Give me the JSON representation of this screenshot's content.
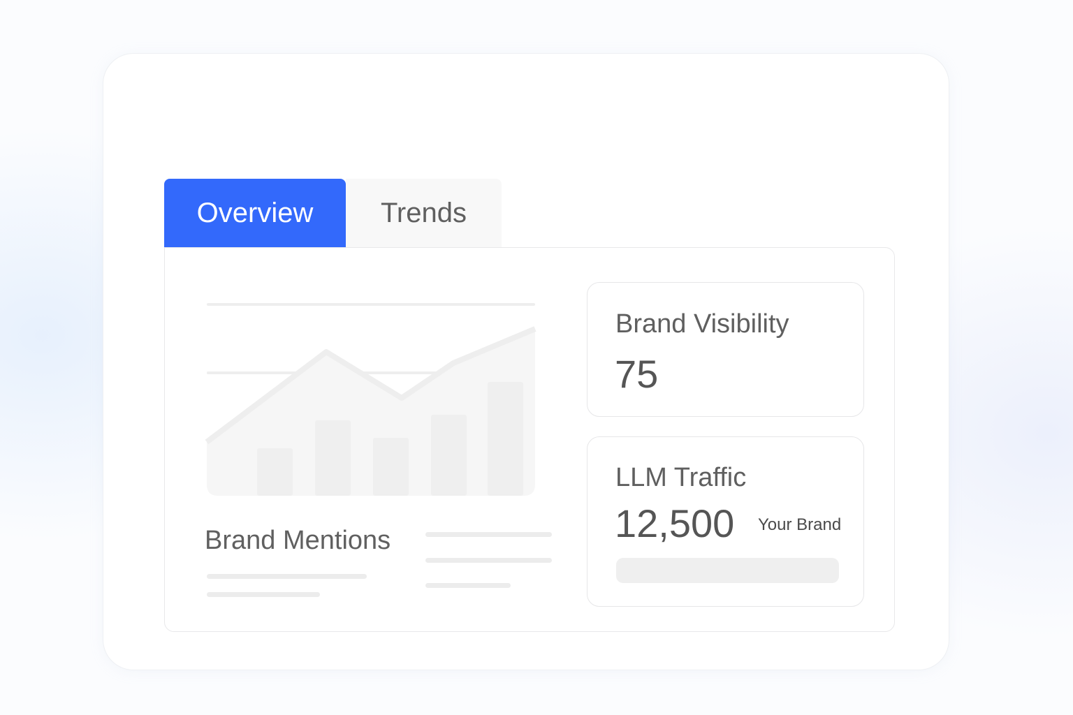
{
  "tabs": [
    {
      "label": "Overview",
      "active": true
    },
    {
      "label": "Trends",
      "active": false
    }
  ],
  "colors": {
    "accent": "#3369fb",
    "text": "#5f5f5f",
    "placeholder": "#f3f3f3"
  },
  "chart": {
    "caption": "Brand Mentions"
  },
  "metrics": {
    "visibility": {
      "label": "Brand Visibility",
      "value": "75"
    },
    "traffic": {
      "label": "LLM Traffic",
      "value": "12,500",
      "legend": "Your Brand"
    }
  }
}
